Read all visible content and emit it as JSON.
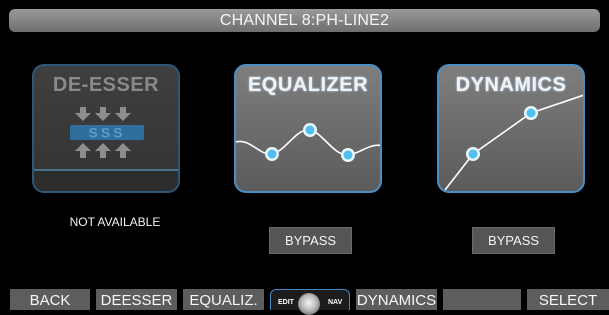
{
  "header": {
    "title": "CHANNEL 8:PH-LINE2"
  },
  "modules": {
    "deesser": {
      "title": "DE-ESSER",
      "letters": "SSS",
      "status": "NOT AVAILABLE"
    },
    "equalizer": {
      "title": "EQUALIZER",
      "bypass_label": "BYPASS"
    },
    "dynamics": {
      "title": "DYNAMICS",
      "bypass_label": "BYPASS"
    }
  },
  "softkeys": {
    "back": "BACK",
    "deesser": "DEESSER",
    "equaliz": "EQUALIZ.",
    "dynamics": "DYNAMICS",
    "blank": "",
    "select": "SELECT"
  },
  "encoder": {
    "left_label": "EDIT",
    "right_label": "NAV"
  },
  "colors": {
    "accent": "#4b8ec4",
    "node": "#5cc6f2",
    "panel_gray": "#6a6a6a"
  }
}
